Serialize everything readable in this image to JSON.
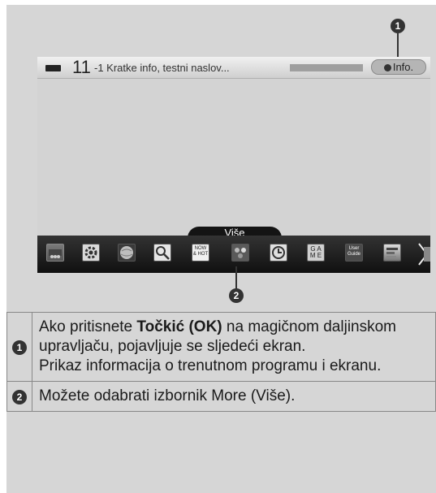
{
  "screen": {
    "channel_number": "11",
    "channel_subtitle": "-1 Kratke info, testni naslov...",
    "info_button_label": "Info.",
    "more_tab_label": "Više",
    "menu_items": [
      {
        "name": "input-icon",
        "label": ""
      },
      {
        "name": "settings-icon",
        "label": ""
      },
      {
        "name": "internet-globe-icon",
        "label": ""
      },
      {
        "name": "search-icon",
        "label": "Search"
      },
      {
        "name": "now-hot-icon",
        "label": "NOW & HOT"
      },
      {
        "name": "smartshare-icon",
        "label": ""
      },
      {
        "name": "clock-icon",
        "label": ""
      },
      {
        "name": "game-icon",
        "label": "G A M E"
      },
      {
        "name": "user-guide-icon",
        "label": "User Guide"
      },
      {
        "name": "app-icon",
        "label": ""
      }
    ]
  },
  "callouts": {
    "top_number": "1",
    "bottom_number": "2"
  },
  "table": {
    "rows": [
      {
        "number": "1",
        "text_before_bold": "Ako pritisnete ",
        "bold": "Točkić (OK)",
        "text_after_bold": " na magičnom daljinskom upravljaču, pojavljuje se sljedeći ekran.",
        "line2": "Prikaz informacija o trenutnom programu i ekranu."
      },
      {
        "number": "2",
        "text": "Možete odabrati izbornik More (Više)."
      }
    ]
  },
  "colors": {
    "page_bg": "#d6d6d6",
    "menubar_bg": "#1a1a1a",
    "badge_bg": "#333333"
  }
}
